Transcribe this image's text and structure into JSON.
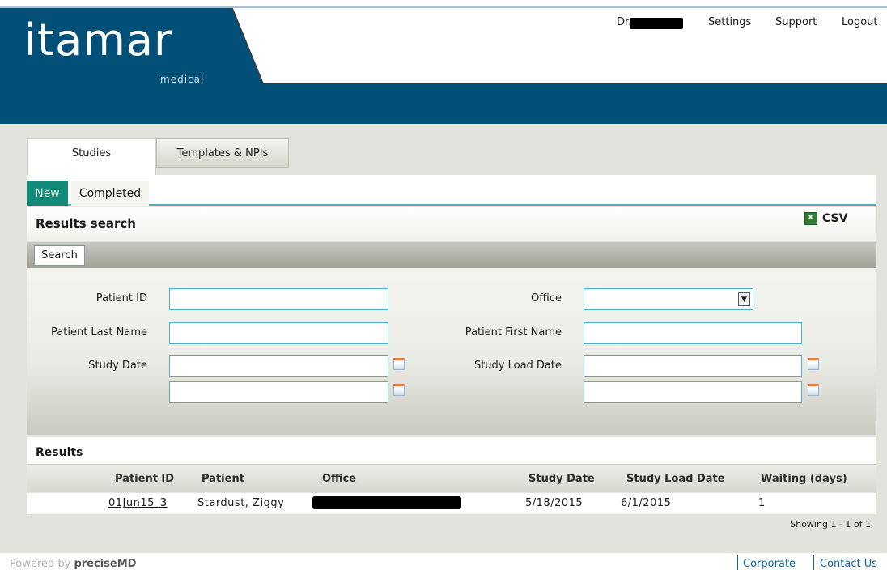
{
  "brand": {
    "logo": "itamar",
    "logo_sub": "medical"
  },
  "topnav": {
    "user_prefix": "Dr.",
    "settings": "Settings",
    "support": "Support",
    "logout": "Logout"
  },
  "tabs": [
    {
      "label": "Studies",
      "active": true
    },
    {
      "label": "Templates & NPIs",
      "active": false
    }
  ],
  "subtabs": [
    {
      "label": "New",
      "active": true
    },
    {
      "label": "Completed",
      "active": false
    }
  ],
  "search_panel": {
    "title": "Results search",
    "csv_label": "CSV",
    "search_button": "Search",
    "fields": {
      "patient_id": {
        "label": "Patient ID",
        "value": ""
      },
      "patient_last_name": {
        "label": "Patient Last Name",
        "value": ""
      },
      "study_date": {
        "label": "Study Date",
        "from": "",
        "to": ""
      },
      "office": {
        "label": "Office",
        "value": ""
      },
      "patient_first_name": {
        "label": "Patient First Name",
        "value": ""
      },
      "study_load_date": {
        "label": "Study Load Date",
        "from": "",
        "to": ""
      }
    }
  },
  "results": {
    "title": "Results",
    "columns": [
      "Patient ID",
      "Patient",
      "Office",
      "Study Date",
      "Study Load Date",
      "Waiting (days)"
    ],
    "rows": [
      {
        "patient_id": "01Jun15_3",
        "patient": "Stardust, Ziggy",
        "office": "",
        "study_date": "5/18/2015",
        "study_load_date": "6/1/2015",
        "waiting": "1"
      }
    ],
    "showing": "Showing 1 - 1 of 1"
  },
  "footer": {
    "powered_prefix": "Powered by",
    "powered_brand": "preciseMD",
    "corporate": "Corporate",
    "contact": "Contact Us"
  },
  "colors": {
    "brand_blue": "#024f77",
    "accent_teal": "#128a7a",
    "link_blue": "#0a66a8"
  }
}
